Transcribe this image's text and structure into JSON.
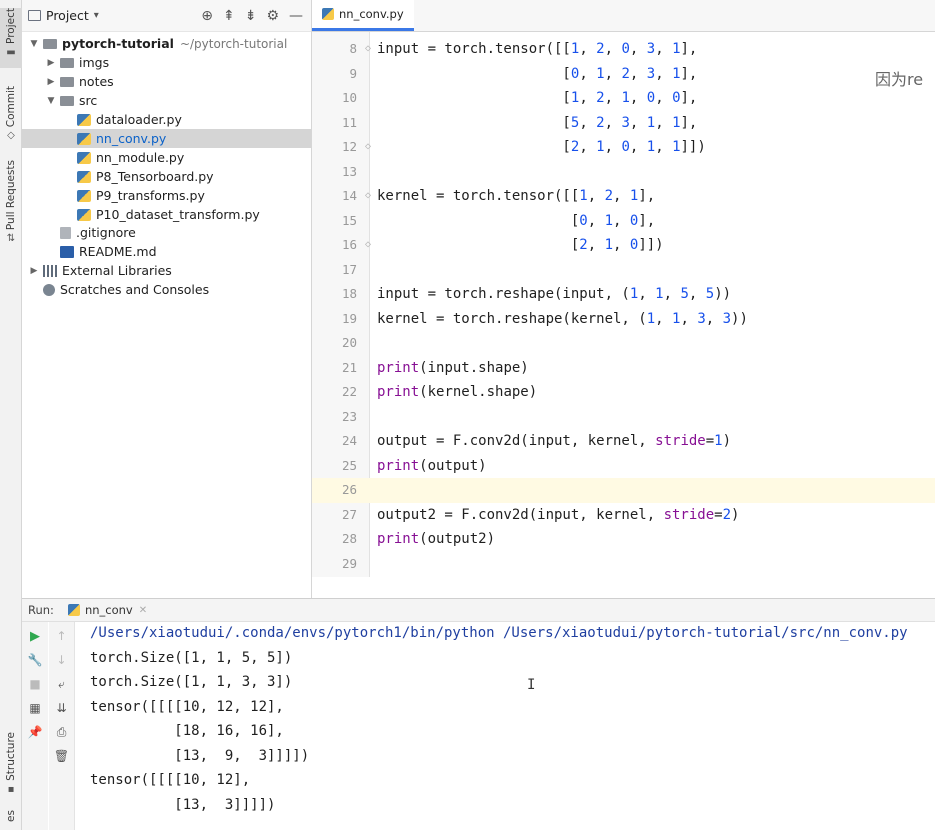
{
  "side_strip": {
    "tabs": [
      {
        "label": "Project",
        "icon": "folder-icon"
      },
      {
        "label": "Commit",
        "icon": "commit-icon"
      },
      {
        "label": "Pull Requests",
        "icon": "pull-request-icon"
      },
      {
        "label": "Structure",
        "icon": "structure-icon"
      },
      {
        "label": "es",
        "icon": ""
      }
    ]
  },
  "project_panel": {
    "title": "Project",
    "tree": [
      {
        "name": "pytorch-tutorial",
        "path": "~/pytorch-tutorial",
        "type": "folder",
        "expanded": true
      },
      {
        "name": "imgs",
        "type": "folder",
        "expanded": false
      },
      {
        "name": "notes",
        "type": "folder",
        "expanded": false
      },
      {
        "name": "src",
        "type": "folder",
        "expanded": true
      },
      {
        "name": "dataloader.py",
        "type": "python"
      },
      {
        "name": "nn_conv.py",
        "type": "python",
        "selected": true
      },
      {
        "name": "nn_module.py",
        "type": "python"
      },
      {
        "name": "P8_Tensorboard.py",
        "type": "python"
      },
      {
        "name": "P9_transforms.py",
        "type": "python"
      },
      {
        "name": "P10_dataset_transform.py",
        "type": "python"
      },
      {
        "name": ".gitignore",
        "type": "text"
      },
      {
        "name": "README.md",
        "type": "markdown"
      },
      {
        "name": "External Libraries",
        "type": "library"
      },
      {
        "name": "Scratches and Consoles",
        "type": "scratch"
      }
    ]
  },
  "editor": {
    "tab": "nn_conv.py",
    "current_line": 26,
    "lines": [
      {
        "n": "8",
        "code": "input = torch.tensor([[1, 2, 0, 3, 1],"
      },
      {
        "n": "9",
        "code": "                      [0, 1, 2, 3, 1],"
      },
      {
        "n": "10",
        "code": "                      [1, 2, 1, 0, 0],"
      },
      {
        "n": "11",
        "code": "                      [5, 2, 3, 1, 1],"
      },
      {
        "n": "12",
        "code": "                      [2, 1, 0, 1, 1]])"
      },
      {
        "n": "13",
        "code": ""
      },
      {
        "n": "14",
        "code": "kernel = torch.tensor([[1, 2, 1],"
      },
      {
        "n": "15",
        "code": "                       [0, 1, 0],"
      },
      {
        "n": "16",
        "code": "                       [2, 1, 0]])"
      },
      {
        "n": "17",
        "code": ""
      },
      {
        "n": "18",
        "code": "input = torch.reshape(input, (1, 1, 5, 5))"
      },
      {
        "n": "19",
        "code": "kernel = torch.reshape(kernel, (1, 1, 3, 3))"
      },
      {
        "n": "20",
        "code": ""
      },
      {
        "n": "21",
        "code": "print(input.shape)"
      },
      {
        "n": "22",
        "code": "print(kernel.shape)"
      },
      {
        "n": "23",
        "code": ""
      },
      {
        "n": "24",
        "code": "output = F.conv2d(input, kernel, stride=1)"
      },
      {
        "n": "25",
        "code": "print(output)"
      },
      {
        "n": "26",
        "code": ""
      },
      {
        "n": "27",
        "code": "output2 = F.conv2d(input, kernel, stride=2)"
      },
      {
        "n": "28",
        "code": "print(output2)"
      },
      {
        "n": "29",
        "code": ""
      }
    ],
    "overlay_text": "因为re"
  },
  "run_panel": {
    "label": "Run:",
    "tab": "nn_conv",
    "output": [
      "/Users/xiaotudui/.conda/envs/pytorch1/bin/python /Users/xiaotudui/pytorch-tutorial/src/nn_conv.py",
      "torch.Size([1, 1, 5, 5])",
      "torch.Size([1, 1, 3, 3])",
      "tensor([[[[10, 12, 12],",
      "          [18, 16, 16],",
      "          [13,  9,  3]]]])",
      "tensor([[[[10, 12],",
      "          [13,  3]]]])"
    ]
  },
  "colors": {
    "accent": "#3b78e7",
    "selected_text": "#0b62c9",
    "keyword_purple": "#871094",
    "number_blue": "#1750eb",
    "current_line": "#fffae3",
    "run_green": "#2fa84f"
  }
}
